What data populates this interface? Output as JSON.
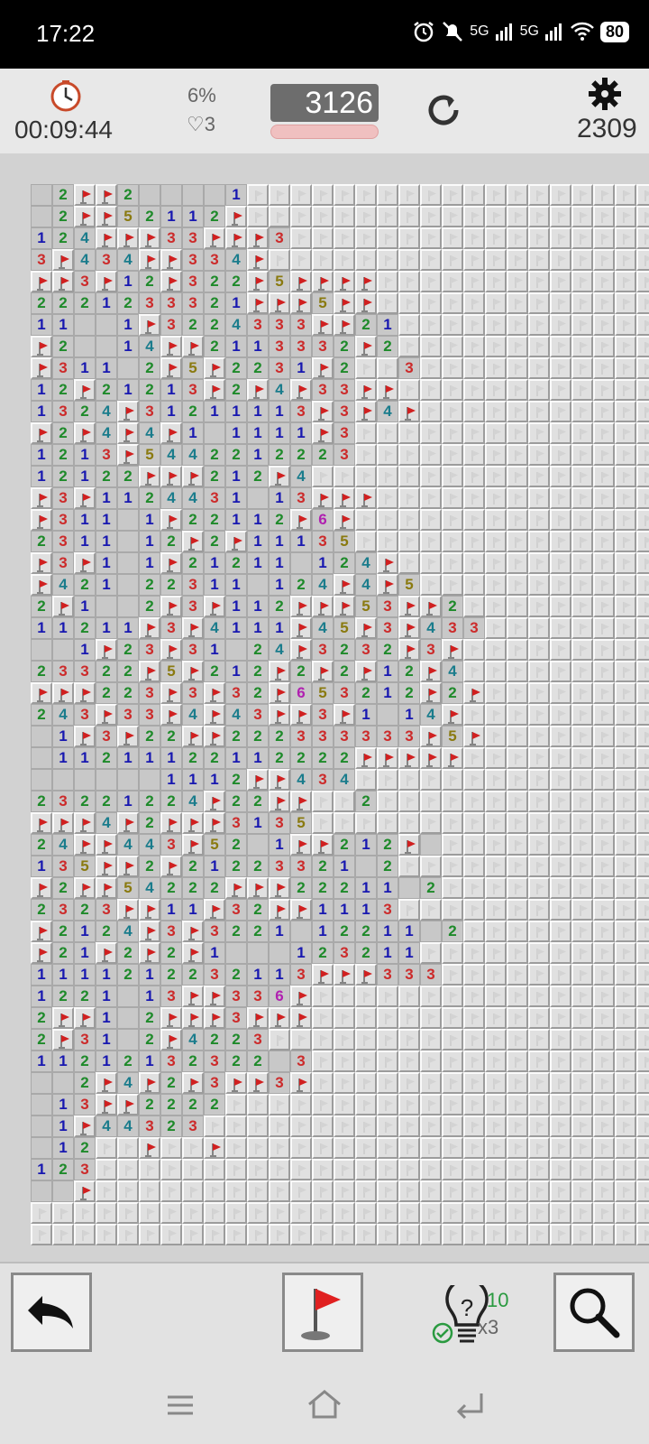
{
  "status_bar": {
    "time": "17:22",
    "network_1": "5G",
    "network_2": "5G",
    "battery": "80"
  },
  "header": {
    "timer": "00:09:44",
    "progress": "6%",
    "lives": "3",
    "score": "3126",
    "mines_left": "2309"
  },
  "toolbar": {
    "hints_available": "10",
    "hint_multiplier": "x3"
  },
  "board": {
    "cols": 29,
    "rows": 49,
    "legend": "c=closed, .=open empty, F=flag, 1-8=number",
    "grid": [
      ".2FF2....1ccccccccccccccccccc",
      ".2FF52112Fcccccccccccccccccc",
      "124FFF33FFF3cccccccccccccccccc",
      "3F434FF334Fcccccccccccccccccc",
      "FF3F12F322F5FFFFcccccccccccc",
      "2221233321FFF5FFcccccccccccc",
      "11..1F3224333FF21ccccccccccc",
      "F2..14FF2113332F2ccccccccccc",
      "F311.2F5F2231F2cc3cccccccccc",
      "12F21213F2F4F33FFccccccccccc",
      "1324F31211113F3F4Fcccccccccc",
      "F2F4F4F1.1111F3ccccccccccccc",
      "1213F5442212223ccccccccccccc",
      "12122FFF212F4ccccccccccccccc",
      "F3F1124431.13FFFcccccccccccc",
      "F311.1F22112F6Fccccccccccccc",
      "2311.12F2F11135ccccccccccccc",
      "F3F1.1F21211.124Fccccccccccc",
      "F421.22311.124F4F5cccccccccc",
      "2F1..2F3F112FFF53FF2cccccccc",
      "11211F3F4111F45F3F433ccccccc",
      "..1F23F31.24F3232F3Fcccccccc",
      "23322F5F212F2F2F12F4cccccccc",
      "FFF223F3F32F653212F2Fccccccc",
      "243F33F4F43FF3F1.14Fcccccccc",
      ".1F3F22FF222333333F5Fccccccc",
      ".11211122112222FFFFFcccccccc",
      "......1112FF434ccccccccccccc",
      "23221224F22FFcc2cccccccccccc",
      "FFF4F2FFF3135ccccccccccccccc",
      "24FF443F52.1FF212F.ccccccccc",
      "135FF2F21223321.2ccccccccccc",
      "F2FF54222FFF22211.2ccccccccc",
      "2323FF11F32FF1113ccccccccccc",
      "F2124F3F3221.12211.2cccccccc",
      "F21F2F2F1...123211cccccccccc",
      "1111212232113FFF333ccccccccc",
      "1221.13FF336Fccccccccccccccc",
      "2FF1.2FFF3FFFccccccccccccccc",
      "2F31.2F4223ccccccccccccccccc",
      "11212132322.3ccccccccccccccc",
      "..2F4F2F3FF3Fccccccccccccccc",
      ".13FF2222ccccccccccccccccccc",
      ".1F44323cccccccccccccccccccc",
      ".12ccFccFccccccccccccccccccc",
      "123ccccccccccccccccccccccccc",
      "..Fccccccccccccccccccccccccc",
      "cccccccccccccccccccccccccccc",
      "cccccccccccccccccccccccccccc"
    ]
  }
}
